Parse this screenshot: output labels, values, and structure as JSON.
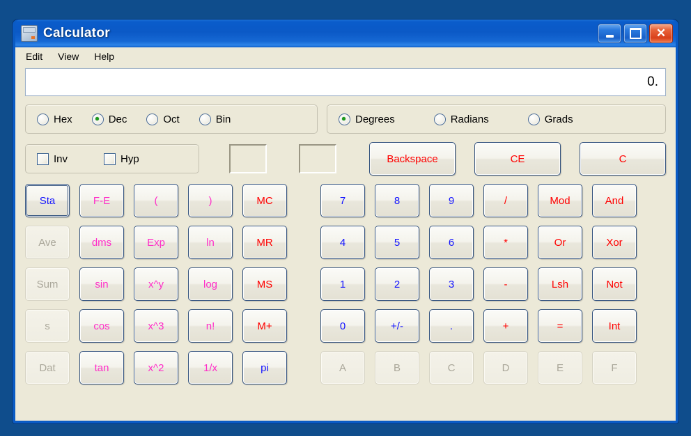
{
  "window": {
    "title": "Calculator",
    "icon": "calculator-icon",
    "controls": {
      "minimize": "minimize",
      "maximize": "maximize",
      "close": "close"
    }
  },
  "menu": {
    "items": [
      "Edit",
      "View",
      "Help"
    ]
  },
  "display": {
    "value": "0."
  },
  "base_group": {
    "options": [
      "Hex",
      "Dec",
      "Oct",
      "Bin"
    ],
    "selected": "Dec"
  },
  "angle_group": {
    "options": [
      "Degrees",
      "Radians",
      "Grads"
    ],
    "selected": "Degrees"
  },
  "modifiers": {
    "options": [
      "Inv",
      "Hyp"
    ],
    "inv_checked": false,
    "hyp_checked": false
  },
  "indicators": [
    "",
    ""
  ],
  "edit_buttons": [
    {
      "label": "Backspace",
      "color": "red"
    },
    {
      "label": "CE",
      "color": "red"
    },
    {
      "label": "C",
      "color": "red"
    }
  ],
  "stat_column": [
    {
      "label": "Sta",
      "color": "blue",
      "enabled": true,
      "focused": true
    },
    {
      "label": "Ave",
      "color": "blue",
      "enabled": false,
      "focused": false
    },
    {
      "label": "Sum",
      "color": "blue",
      "enabled": false,
      "focused": false
    },
    {
      "label": "s",
      "color": "blue",
      "enabled": false,
      "focused": false
    },
    {
      "label": "Dat",
      "color": "blue",
      "enabled": false,
      "focused": false
    }
  ],
  "function_rows": [
    [
      {
        "label": "F-E",
        "color": "magenta"
      },
      {
        "label": "(",
        "color": "magenta"
      },
      {
        "label": ")",
        "color": "magenta"
      }
    ],
    [
      {
        "label": "dms",
        "color": "magenta"
      },
      {
        "label": "Exp",
        "color": "magenta"
      },
      {
        "label": "ln",
        "color": "magenta"
      }
    ],
    [
      {
        "label": "sin",
        "color": "magenta"
      },
      {
        "label": "x^y",
        "color": "magenta"
      },
      {
        "label": "log",
        "color": "magenta"
      }
    ],
    [
      {
        "label": "cos",
        "color": "magenta"
      },
      {
        "label": "x^3",
        "color": "magenta"
      },
      {
        "label": "n!",
        "color": "magenta"
      }
    ],
    [
      {
        "label": "tan",
        "color": "magenta"
      },
      {
        "label": "x^2",
        "color": "magenta"
      },
      {
        "label": "1/x",
        "color": "magenta"
      }
    ]
  ],
  "memory_column": [
    {
      "label": "MC",
      "color": "red"
    },
    {
      "label": "MR",
      "color": "red"
    },
    {
      "label": "MS",
      "color": "red"
    },
    {
      "label": "M+",
      "color": "red"
    },
    {
      "label": "pi",
      "color": "blue"
    }
  ],
  "keypad_rows": [
    [
      {
        "label": "7",
        "color": "blue",
        "enabled": true
      },
      {
        "label": "8",
        "color": "blue",
        "enabled": true
      },
      {
        "label": "9",
        "color": "blue",
        "enabled": true
      },
      {
        "label": "/",
        "color": "red",
        "enabled": true
      },
      {
        "label": "Mod",
        "color": "red",
        "enabled": true
      },
      {
        "label": "And",
        "color": "red",
        "enabled": true
      }
    ],
    [
      {
        "label": "4",
        "color": "blue",
        "enabled": true
      },
      {
        "label": "5",
        "color": "blue",
        "enabled": true
      },
      {
        "label": "6",
        "color": "blue",
        "enabled": true
      },
      {
        "label": "*",
        "color": "red",
        "enabled": true
      },
      {
        "label": "Or",
        "color": "red",
        "enabled": true
      },
      {
        "label": "Xor",
        "color": "red",
        "enabled": true
      }
    ],
    [
      {
        "label": "1",
        "color": "blue",
        "enabled": true
      },
      {
        "label": "2",
        "color": "blue",
        "enabled": true
      },
      {
        "label": "3",
        "color": "blue",
        "enabled": true
      },
      {
        "label": "-",
        "color": "red",
        "enabled": true
      },
      {
        "label": "Lsh",
        "color": "red",
        "enabled": true
      },
      {
        "label": "Not",
        "color": "red",
        "enabled": true
      }
    ],
    [
      {
        "label": "0",
        "color": "blue",
        "enabled": true
      },
      {
        "label": "+/-",
        "color": "blue",
        "enabled": true
      },
      {
        "label": ".",
        "color": "blue",
        "enabled": true
      },
      {
        "label": "+",
        "color": "red",
        "enabled": true
      },
      {
        "label": "=",
        "color": "red",
        "enabled": true
      },
      {
        "label": "Int",
        "color": "red",
        "enabled": true
      }
    ],
    [
      {
        "label": "A",
        "color": "blue",
        "enabled": false
      },
      {
        "label": "B",
        "color": "blue",
        "enabled": false
      },
      {
        "label": "C",
        "color": "blue",
        "enabled": false
      },
      {
        "label": "D",
        "color": "blue",
        "enabled": false
      },
      {
        "label": "E",
        "color": "blue",
        "enabled": false
      },
      {
        "label": "F",
        "color": "blue",
        "enabled": false
      }
    ]
  ],
  "colors": {
    "titlebar": "#0a5ccb",
    "client": "#ece9d8",
    "red": "#ff0000",
    "blue": "#1414ff",
    "magenta": "#ff2ec8",
    "desktop": "#0f4d8c"
  }
}
